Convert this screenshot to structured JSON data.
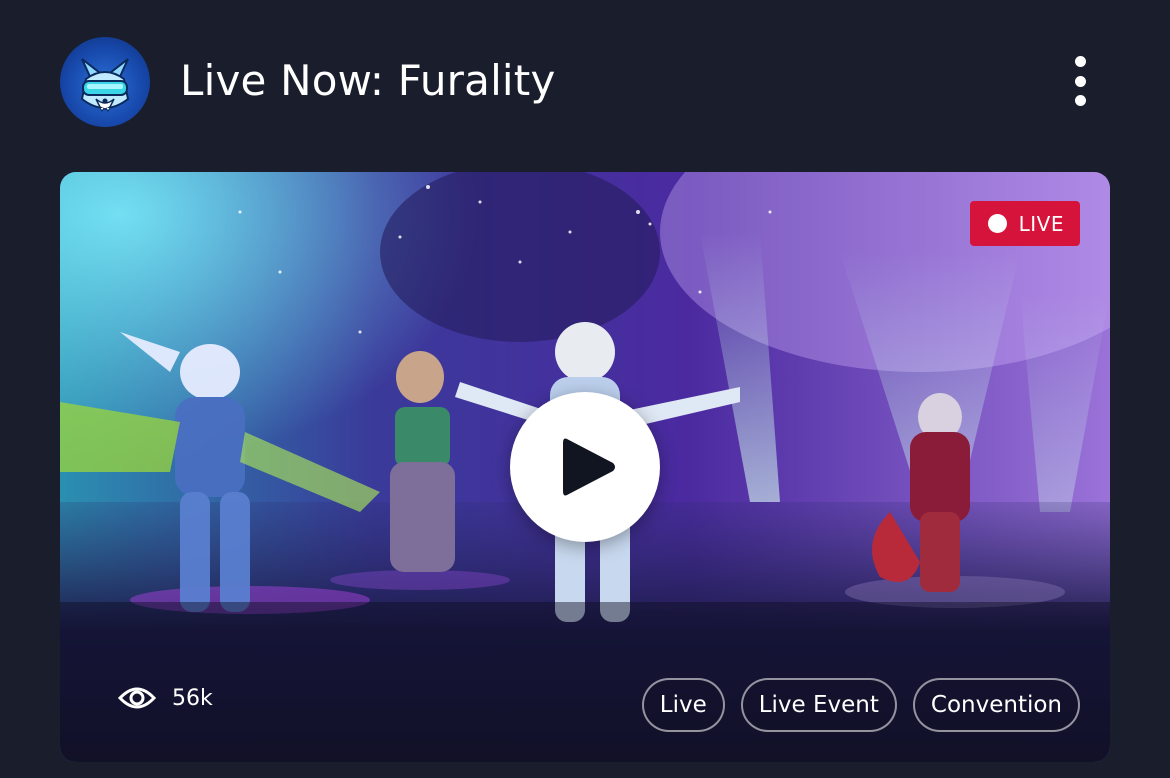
{
  "header": {
    "title": "Live Now: Furality",
    "avatar_icon": "wolf-vr-headset-avatar",
    "more_icon": "more-vertical-icon"
  },
  "video": {
    "live_label": "LIVE",
    "live_color": "#d5133b",
    "play_icon": "play-icon",
    "views_icon": "eye-icon",
    "views": "56k",
    "tags": [
      {
        "label": "Live"
      },
      {
        "label": "Live Event"
      },
      {
        "label": "Convention"
      }
    ]
  },
  "colors": {
    "background": "#1a1e2c",
    "accent": "#d5133b"
  }
}
